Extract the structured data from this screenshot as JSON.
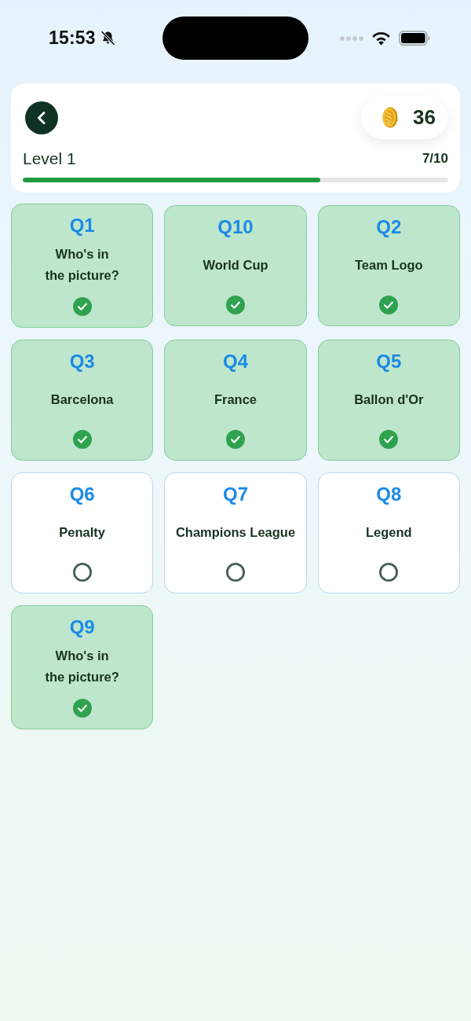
{
  "status_bar": {
    "time": "15:53"
  },
  "header": {
    "coins": "36",
    "level_label": "Level 1",
    "progress_text": "7/10",
    "progress": {
      "level": 0.7
    }
  },
  "questions": [
    {
      "number": "Q1",
      "title": "Who's in\nthe picture?",
      "completed": true
    },
    {
      "number": "Q10",
      "title": "World Cup",
      "completed": true
    },
    {
      "number": "Q2",
      "title": "Team Logo",
      "completed": true
    },
    {
      "number": "Q3",
      "title": "Barcelona",
      "completed": true
    },
    {
      "number": "Q4",
      "title": "France",
      "completed": true
    },
    {
      "number": "Q5",
      "title": "Ballon d'Or",
      "completed": true
    },
    {
      "number": "Q6",
      "title": "Penalty",
      "completed": false
    },
    {
      "number": "Q7",
      "title": "Champions League",
      "completed": false
    },
    {
      "number": "Q8",
      "title": "Legend",
      "completed": false
    },
    {
      "number": "Q9",
      "title": "Who's in\nthe picture?",
      "completed": true
    }
  ]
}
